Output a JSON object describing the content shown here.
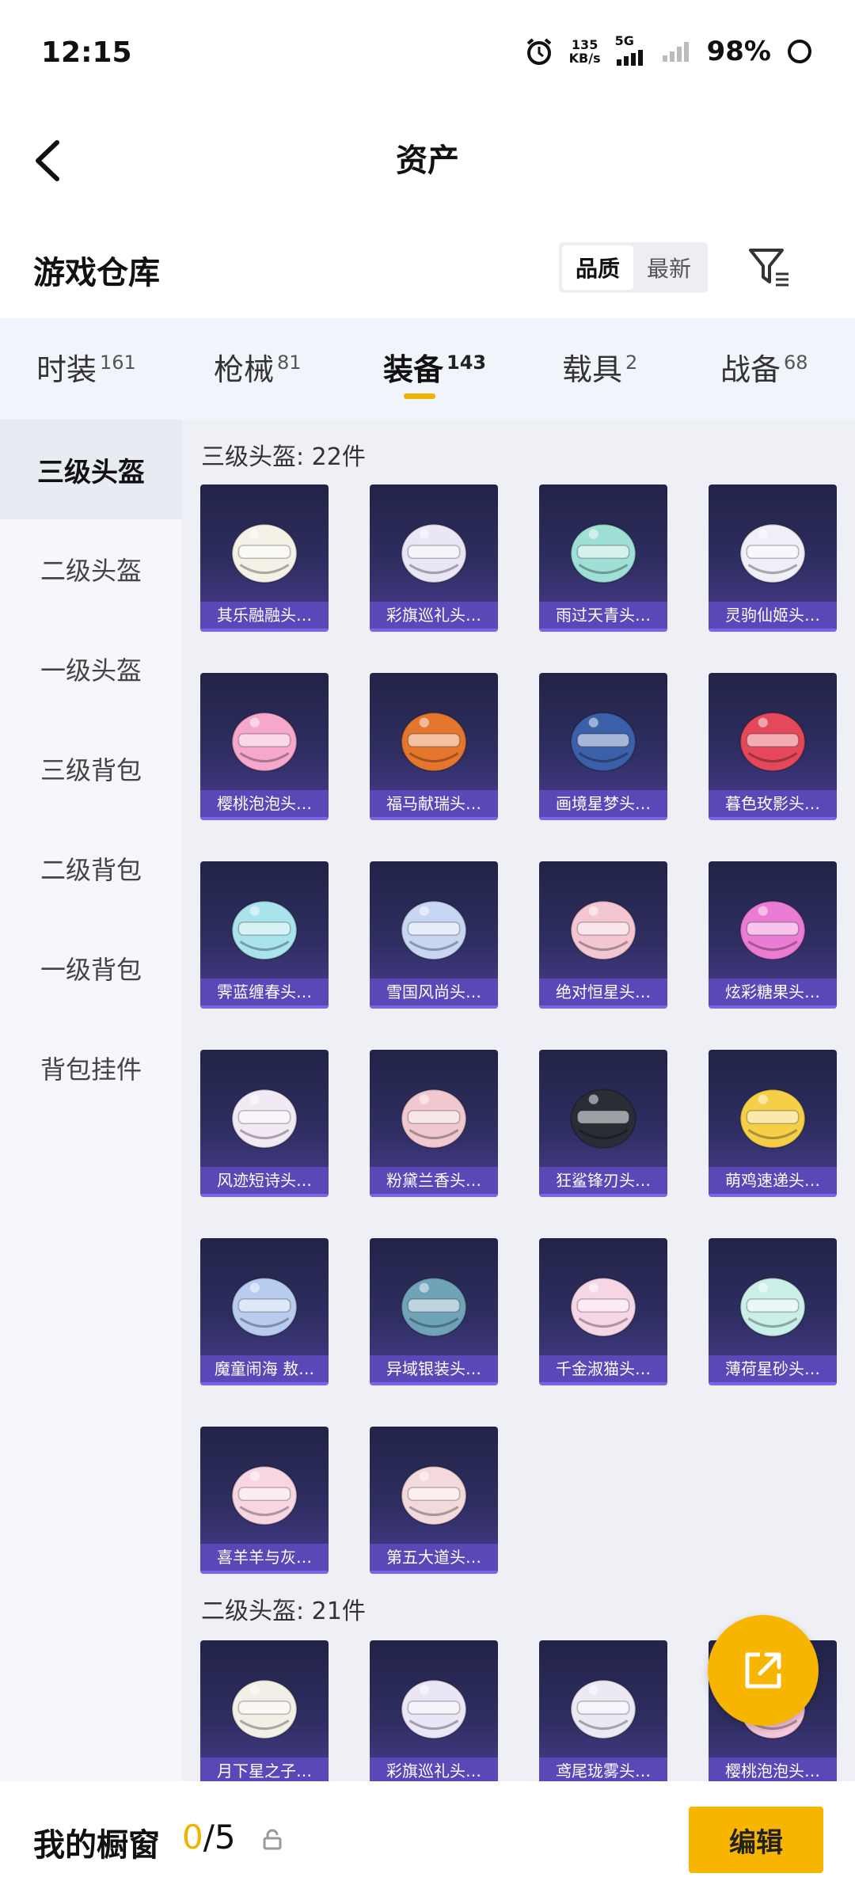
{
  "status": {
    "time": "12:15",
    "speed_value": "135",
    "speed_unit": "KB/s",
    "network": "5G",
    "battery": "98%"
  },
  "header": {
    "title": "资产"
  },
  "warehouse": {
    "title": "游戏仓库",
    "sort": [
      "品质",
      "最新"
    ]
  },
  "categories": [
    {
      "label": "时装",
      "count": "161"
    },
    {
      "label": "枪械",
      "count": "81"
    },
    {
      "label": "装备",
      "count": "143"
    },
    {
      "label": "载具",
      "count": "2"
    },
    {
      "label": "战备",
      "count": "68"
    }
  ],
  "sidebar": [
    "三级头盔",
    "二级头盔",
    "一级头盔",
    "三级背包",
    "二级背包",
    "一级背包",
    "背包挂件"
  ],
  "sections": [
    {
      "title": "三级头盔: 22件",
      "items": [
        "其乐融融头…",
        "彩旗巡礼头…",
        "雨过天青头…",
        "灵驹仙姬头…",
        "樱桃泡泡头…",
        "福马献瑞头…",
        "画境星梦头…",
        "暮色玫影头…",
        "霁蓝缠春头…",
        "雪国风尚头…",
        "绝对恒星头…",
        "炫彩糖果头…",
        "风迹短诗头…",
        "粉黛兰香头…",
        "狂鲨锋刃头…",
        "萌鸡速递头…",
        "魔童闹海 敖…",
        "异域银装头…",
        "千金淑猫头…",
        "薄荷星砂头…",
        "喜羊羊与灰…",
        "第五大道头…"
      ]
    },
    {
      "title": "二级头盔: 21件",
      "items": [
        "月下星之子…",
        "彩旗巡礼头…",
        "鸢尾珑雾头…",
        "樱桃泡泡头…"
      ]
    }
  ],
  "helmet_colors": [
    "#f4f1e6",
    "#eae6f6",
    "#9fe0d6",
    "#f0eef6",
    "#f6a8cc",
    "#e5762e",
    "#3b5fa8",
    "#e5485a",
    "#a9e3ec",
    "#c8d6f4",
    "#f4c6d2",
    "#ea7cd4",
    "#f2e9f4",
    "#f1c8cf",
    "#2a2d36",
    "#f6cf48",
    "#b8ccf0",
    "#6fa3b8",
    "#f6d6e4",
    "#c9efe8",
    "#f7d6e2",
    "#f4d9dc",
    "#f2efe6",
    "#eae6f6",
    "#ece8f4",
    "#f6c6da"
  ],
  "bottom": {
    "label": "我的橱窗",
    "count_num": "0",
    "count_total": "/5",
    "edit": "编辑"
  }
}
